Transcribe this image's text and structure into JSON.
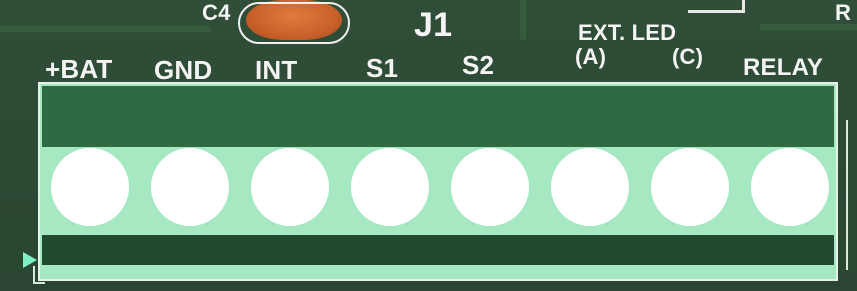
{
  "header": {
    "component_label": "C4",
    "connector_label": "J1",
    "ext_led_label": "EXT. LED",
    "corner_label": "R"
  },
  "pins": [
    {
      "label": "+BAT"
    },
    {
      "label": "GND"
    },
    {
      "label": "INT"
    },
    {
      "label": "S1"
    },
    {
      "label": "S2"
    },
    {
      "label": "(A)"
    },
    {
      "label": "(C)"
    },
    {
      "label": "RELAY"
    }
  ],
  "colors": {
    "pcb": "#2c4a34",
    "connector_body": "#a6e8c2",
    "connector_top": "#2f6b42",
    "connector_bottom": "#1f4a2f",
    "silkscreen": "#f4f4f4",
    "capacitor": "#c9612a",
    "pin1_marker": "#7ef0c4"
  }
}
